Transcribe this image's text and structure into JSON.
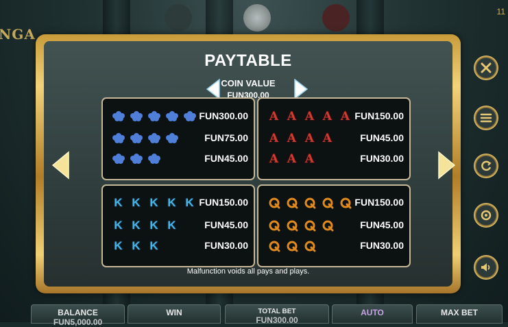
{
  "page": {
    "title": "PAYTABLE",
    "coin_value_label": "COIN VALUE",
    "coin_value": "FUN300.00",
    "footnote": "Malfunction voids all pays and plays.",
    "logo_fragment": "NGA",
    "top_corner_number": "11"
  },
  "colors": {
    "frame_gold": "#e7c772",
    "panel_bg": "#3a4a49",
    "box_bg": "#0c1112",
    "arrow_white": "#ffffff",
    "arrow_gold": "#f5e39a",
    "A_red": "#d03a30",
    "K_blue": "#4ab3e6",
    "Q_orange": "#e08a1e",
    "leaf_blue": "#4f7fd8"
  },
  "paytable": [
    {
      "symbol": "blue-leaf-flower",
      "rows": [
        {
          "count": 5,
          "pay": "FUN300.00"
        },
        {
          "count": 4,
          "pay": "FUN75.00"
        },
        {
          "count": 3,
          "pay": "FUN45.00"
        }
      ]
    },
    {
      "symbol": "A",
      "rows": [
        {
          "count": 5,
          "pay": "FUN150.00"
        },
        {
          "count": 4,
          "pay": "FUN45.00"
        },
        {
          "count": 3,
          "pay": "FUN30.00"
        }
      ]
    },
    {
      "symbol": "K",
      "rows": [
        {
          "count": 5,
          "pay": "FUN150.00"
        },
        {
          "count": 4,
          "pay": "FUN45.00"
        },
        {
          "count": 3,
          "pay": "FUN30.00"
        }
      ]
    },
    {
      "symbol": "Q",
      "rows": [
        {
          "count": 5,
          "pay": "FUN150.00"
        },
        {
          "count": 4,
          "pay": "FUN45.00"
        },
        {
          "count": 3,
          "pay": "FUN30.00"
        }
      ]
    }
  ],
  "side_buttons": [
    {
      "icon": "close-icon"
    },
    {
      "icon": "menu-icon"
    },
    {
      "icon": "refresh-icon"
    },
    {
      "icon": "settings-gear-icon"
    },
    {
      "icon": "sound-icon"
    }
  ],
  "bottom_bar": {
    "balance_label": "BALANCE",
    "balance_value": "FUN5,000.00",
    "win_label": "WIN",
    "total_bet_label": "TOTAL BET",
    "total_bet_value": "FUN300.00",
    "auto_label": "AUTO",
    "max_bet_label": "MAX BET"
  }
}
